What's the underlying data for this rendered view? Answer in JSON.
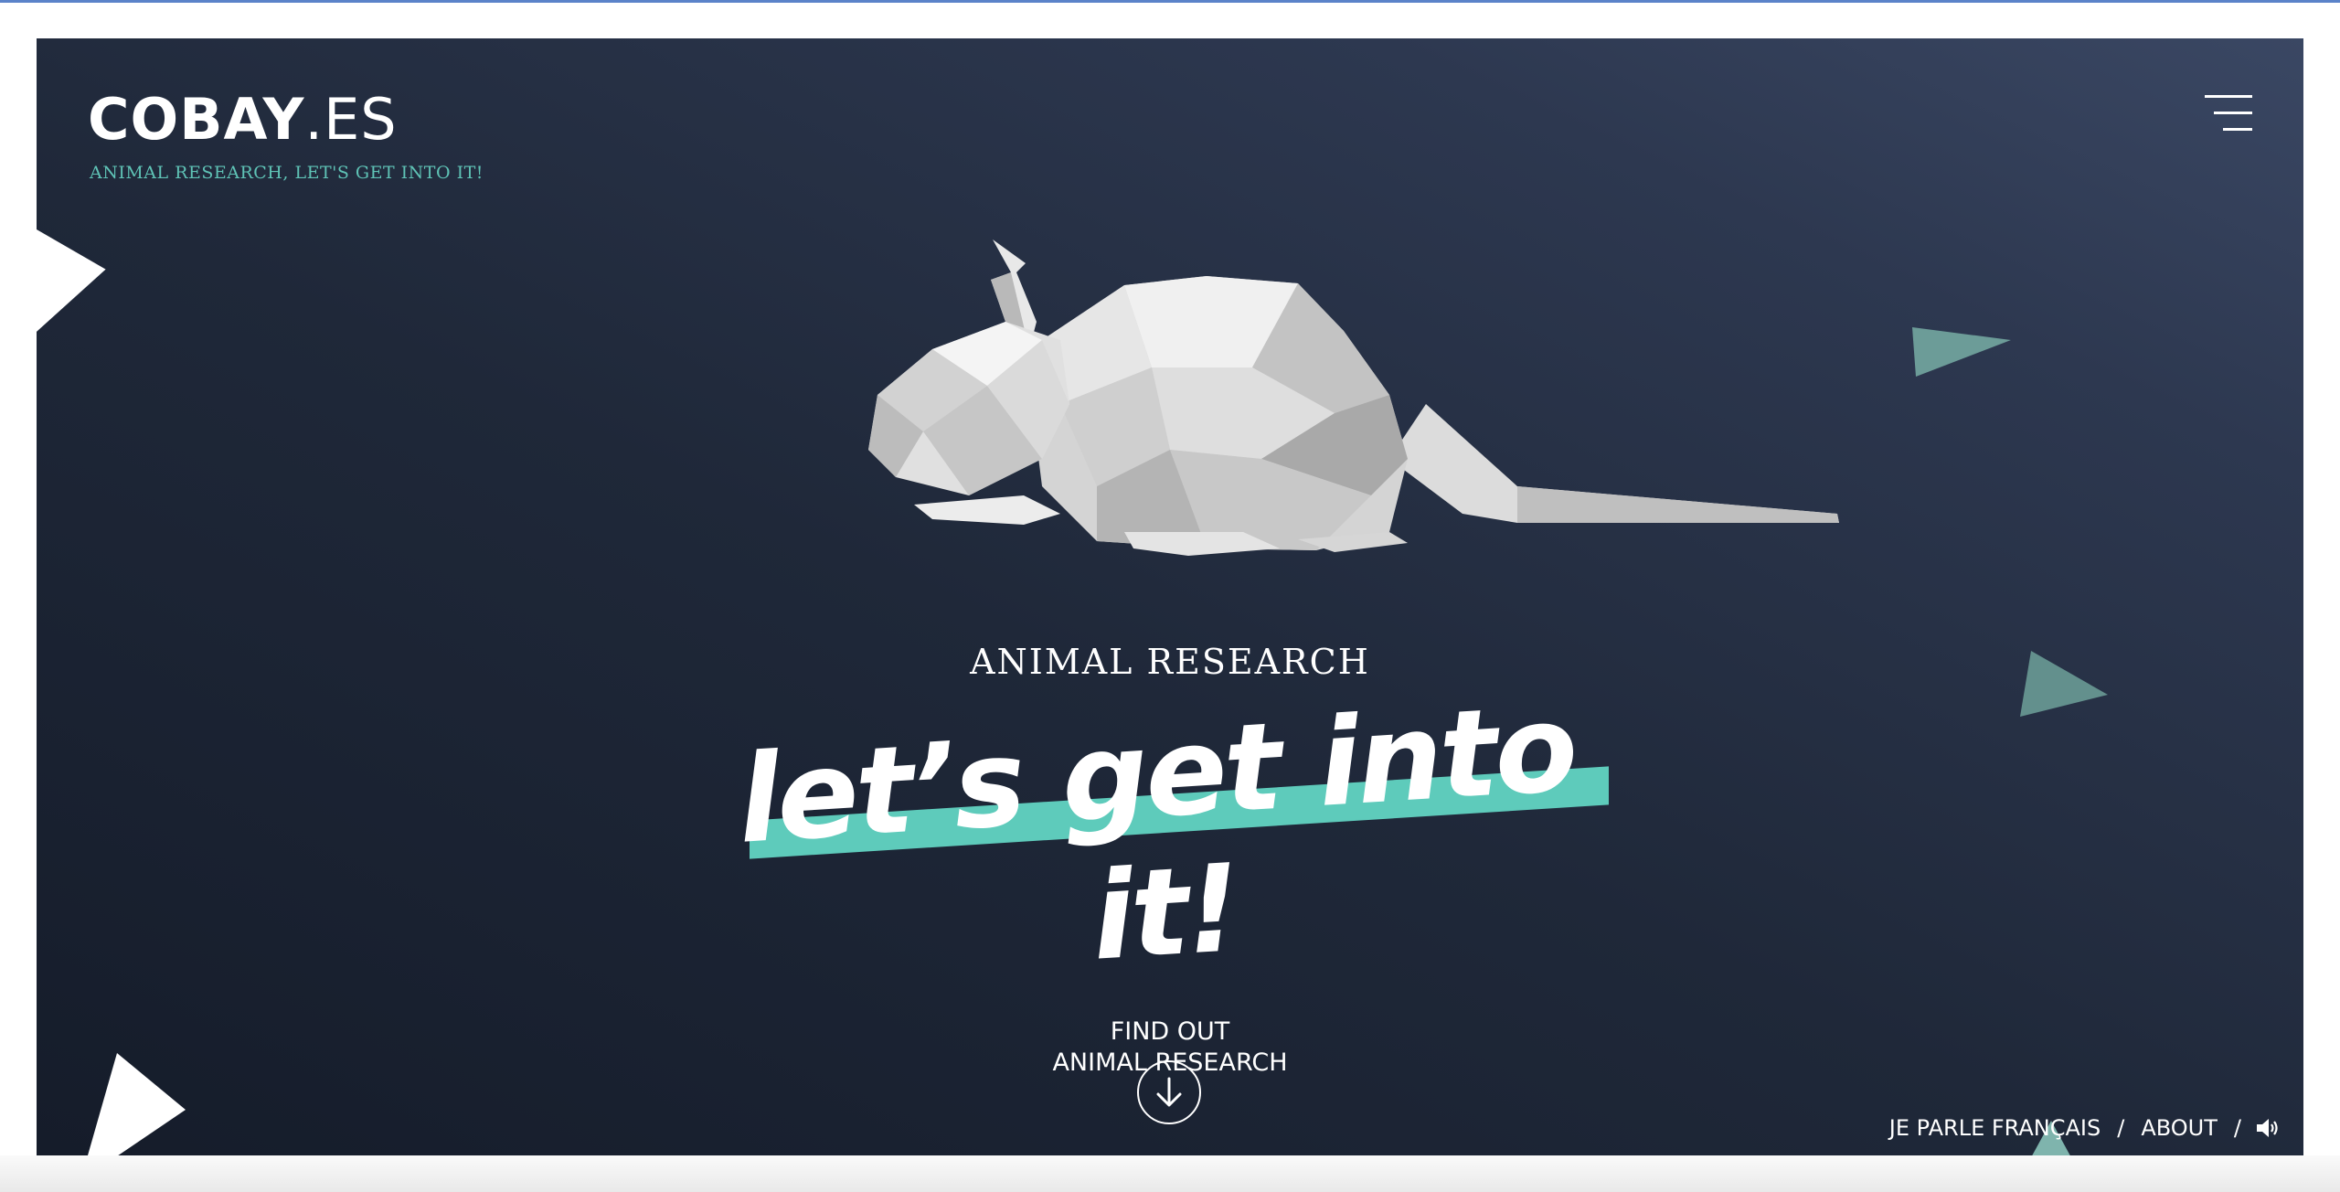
{
  "header": {
    "logo_bold": "COBAY",
    "logo_light": ".ES",
    "tagline": "ANIMAL RESEARCH, LET'S GET INTO IT!",
    "menu_icon": "hamburger-menu-icon"
  },
  "hero": {
    "kicker": "ANIMAL RESEARCH",
    "headline": "let’s get into it!",
    "accent_color": "#5ecbbb",
    "illustration": "low-poly-rat-illustration"
  },
  "cta": {
    "line1": "FIND OUT",
    "line2": "ANIMAL RESEARCH",
    "icon": "arrow-down-circle-icon"
  },
  "footer": {
    "language_link": "JE PARLE FRANÇAIS",
    "separator": "/",
    "about_link": "ABOUT",
    "sound_icon": "speaker-icon"
  },
  "colors": {
    "background_dark": "#151c2a",
    "background_light": "#3a4763",
    "teal": "#5ecbbb",
    "tagline": "#5fc3b6"
  }
}
